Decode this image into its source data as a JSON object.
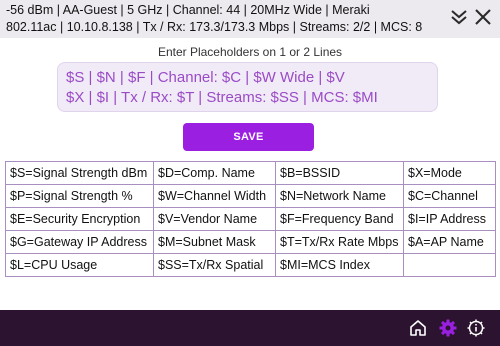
{
  "header": {
    "status_line_1": "-56 dBm | AA-Guest | 5 GHz | Channel: 44 | 20MHz Wide | Meraki",
    "status_line_2": "802.11ac | 10.10.8.138 | Tx / Rx: 173.3/173.3 Mbps | Streams: 2/2 | MCS: 8",
    "collapse_icon": "double-chevron-down-icon",
    "close_icon": "close-icon"
  },
  "editor": {
    "label": "Enter Placeholders on 1 or 2 Lines",
    "line_1": "$S | $N | $F | Channel: $C | $W Wide | $V",
    "line_2": "$X | $I | Tx / Rx: $T | Streams: $SS | MCS: $MI",
    "save_label": "SAVE"
  },
  "legend": [
    [
      "$S=Signal Strength dBm",
      "$D=Comp. Name",
      "$B=BSSID",
      "$X=Mode"
    ],
    [
      "$P=Signal Strength %",
      "$W=Channel Width",
      "$N=Network Name",
      "$C=Channel"
    ],
    [
      "$E=Security Encryption",
      "$V=Vendor Name",
      "$F=Frequency Band",
      "$I=IP Address"
    ],
    [
      "$G=Gateway IP Address",
      "$M=Subnet Mask",
      "$T=Tx/Rx Rate Mbps",
      "$A=AP Name"
    ],
    [
      "$L=CPU Usage",
      "$SS=Tx/Rx Spatial",
      "$MI=MCS Index",
      ""
    ]
  ],
  "footer": {
    "icons": [
      "home-icon",
      "gear-icon",
      "info-gear-icon"
    ]
  },
  "colors": {
    "accent": "#9b1fe0",
    "placeholder_text": "#9a4cc6",
    "placeholder_bg": "#f1eaf7",
    "footer_bg": "#2c1431",
    "header_bg": "#ece9ef",
    "table_border": "#a88fc0"
  }
}
